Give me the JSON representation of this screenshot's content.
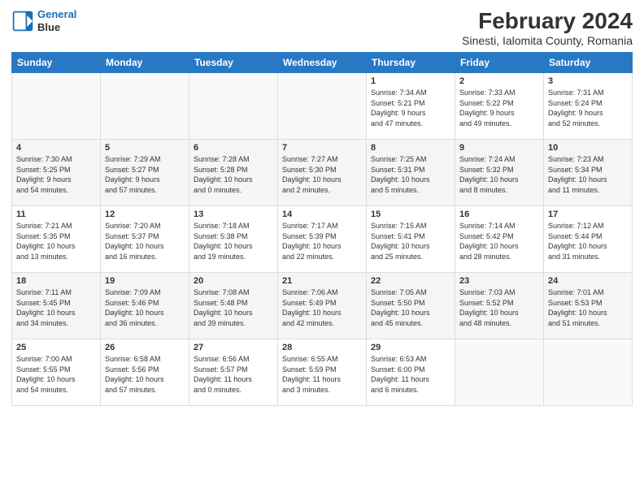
{
  "header": {
    "logo_line1": "General",
    "logo_line2": "Blue",
    "title": "February 2024",
    "subtitle": "Sinesti, Ialomita County, Romania"
  },
  "days_of_week": [
    "Sunday",
    "Monday",
    "Tuesday",
    "Wednesday",
    "Thursday",
    "Friday",
    "Saturday"
  ],
  "weeks": [
    [
      {
        "day": "",
        "content": ""
      },
      {
        "day": "",
        "content": ""
      },
      {
        "day": "",
        "content": ""
      },
      {
        "day": "",
        "content": ""
      },
      {
        "day": "1",
        "content": "Sunrise: 7:34 AM\nSunset: 5:21 PM\nDaylight: 9 hours\nand 47 minutes."
      },
      {
        "day": "2",
        "content": "Sunrise: 7:33 AM\nSunset: 5:22 PM\nDaylight: 9 hours\nand 49 minutes."
      },
      {
        "day": "3",
        "content": "Sunrise: 7:31 AM\nSunset: 5:24 PM\nDaylight: 9 hours\nand 52 minutes."
      }
    ],
    [
      {
        "day": "4",
        "content": "Sunrise: 7:30 AM\nSunset: 5:25 PM\nDaylight: 9 hours\nand 54 minutes."
      },
      {
        "day": "5",
        "content": "Sunrise: 7:29 AM\nSunset: 5:27 PM\nDaylight: 9 hours\nand 57 minutes."
      },
      {
        "day": "6",
        "content": "Sunrise: 7:28 AM\nSunset: 5:28 PM\nDaylight: 10 hours\nand 0 minutes."
      },
      {
        "day": "7",
        "content": "Sunrise: 7:27 AM\nSunset: 5:30 PM\nDaylight: 10 hours\nand 2 minutes."
      },
      {
        "day": "8",
        "content": "Sunrise: 7:25 AM\nSunset: 5:31 PM\nDaylight: 10 hours\nand 5 minutes."
      },
      {
        "day": "9",
        "content": "Sunrise: 7:24 AM\nSunset: 5:32 PM\nDaylight: 10 hours\nand 8 minutes."
      },
      {
        "day": "10",
        "content": "Sunrise: 7:23 AM\nSunset: 5:34 PM\nDaylight: 10 hours\nand 11 minutes."
      }
    ],
    [
      {
        "day": "11",
        "content": "Sunrise: 7:21 AM\nSunset: 5:35 PM\nDaylight: 10 hours\nand 13 minutes."
      },
      {
        "day": "12",
        "content": "Sunrise: 7:20 AM\nSunset: 5:37 PM\nDaylight: 10 hours\nand 16 minutes."
      },
      {
        "day": "13",
        "content": "Sunrise: 7:18 AM\nSunset: 5:38 PM\nDaylight: 10 hours\nand 19 minutes."
      },
      {
        "day": "14",
        "content": "Sunrise: 7:17 AM\nSunset: 5:39 PM\nDaylight: 10 hours\nand 22 minutes."
      },
      {
        "day": "15",
        "content": "Sunrise: 7:15 AM\nSunset: 5:41 PM\nDaylight: 10 hours\nand 25 minutes."
      },
      {
        "day": "16",
        "content": "Sunrise: 7:14 AM\nSunset: 5:42 PM\nDaylight: 10 hours\nand 28 minutes."
      },
      {
        "day": "17",
        "content": "Sunrise: 7:12 AM\nSunset: 5:44 PM\nDaylight: 10 hours\nand 31 minutes."
      }
    ],
    [
      {
        "day": "18",
        "content": "Sunrise: 7:11 AM\nSunset: 5:45 PM\nDaylight: 10 hours\nand 34 minutes."
      },
      {
        "day": "19",
        "content": "Sunrise: 7:09 AM\nSunset: 5:46 PM\nDaylight: 10 hours\nand 36 minutes."
      },
      {
        "day": "20",
        "content": "Sunrise: 7:08 AM\nSunset: 5:48 PM\nDaylight: 10 hours\nand 39 minutes."
      },
      {
        "day": "21",
        "content": "Sunrise: 7:06 AM\nSunset: 5:49 PM\nDaylight: 10 hours\nand 42 minutes."
      },
      {
        "day": "22",
        "content": "Sunrise: 7:05 AM\nSunset: 5:50 PM\nDaylight: 10 hours\nand 45 minutes."
      },
      {
        "day": "23",
        "content": "Sunrise: 7:03 AM\nSunset: 5:52 PM\nDaylight: 10 hours\nand 48 minutes."
      },
      {
        "day": "24",
        "content": "Sunrise: 7:01 AM\nSunset: 5:53 PM\nDaylight: 10 hours\nand 51 minutes."
      }
    ],
    [
      {
        "day": "25",
        "content": "Sunrise: 7:00 AM\nSunset: 5:55 PM\nDaylight: 10 hours\nand 54 minutes."
      },
      {
        "day": "26",
        "content": "Sunrise: 6:58 AM\nSunset: 5:56 PM\nDaylight: 10 hours\nand 57 minutes."
      },
      {
        "day": "27",
        "content": "Sunrise: 6:56 AM\nSunset: 5:57 PM\nDaylight: 11 hours\nand 0 minutes."
      },
      {
        "day": "28",
        "content": "Sunrise: 6:55 AM\nSunset: 5:59 PM\nDaylight: 11 hours\nand 3 minutes."
      },
      {
        "day": "29",
        "content": "Sunrise: 6:53 AM\nSunset: 6:00 PM\nDaylight: 11 hours\nand 6 minutes."
      },
      {
        "day": "",
        "content": ""
      },
      {
        "day": "",
        "content": ""
      }
    ]
  ]
}
